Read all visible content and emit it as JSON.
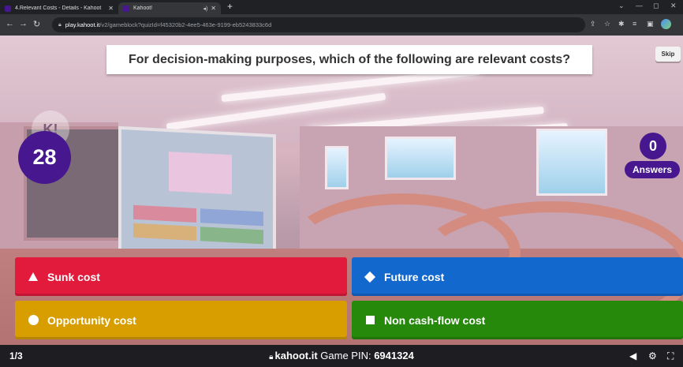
{
  "browser": {
    "tabs": [
      {
        "title": "4.Relevant Costs - Details - Kahoot",
        "close": "✕"
      },
      {
        "title": "Kahoot!",
        "close": "✕",
        "audio": "◂)"
      }
    ],
    "new_tab": "+",
    "window_controls": {
      "minimize": "—",
      "restore": "◻",
      "close": "✕",
      "collapse": "⌄"
    },
    "url_host": "play.kahoot.it",
    "url_path": "/v2/gameblock?quizId=f45320b2-4ee5-463e-9199-eb5243833c6d"
  },
  "game": {
    "question": "For decision-making purposes, which of the following are relevant costs?",
    "skip_label": "Skip",
    "timer": "28",
    "answers_count": "0",
    "answers_label": "Answers",
    "logo_text": "K!",
    "options": [
      {
        "label": "Sunk cost",
        "color": "#e21b3c",
        "shape": "triangle"
      },
      {
        "label": "Future cost",
        "color": "#1368ce",
        "shape": "diamond"
      },
      {
        "label": "Opportunity cost",
        "color": "#d89e00",
        "shape": "circle"
      },
      {
        "label": "Non cash-flow cost",
        "color": "#26890c",
        "shape": "square"
      }
    ]
  },
  "footer": {
    "progress": "1/3",
    "site": "kahoot.it",
    "pin_label": "Game PIN:",
    "pin": "6941324"
  },
  "icons": [
    "back-icon",
    "forward-icon",
    "reload-icon",
    "lock-icon",
    "share-icon",
    "star-icon",
    "extensions-icon",
    "reading-list-icon",
    "sidepanel-icon",
    "volume-icon",
    "settings-icon",
    "fullscreen-icon"
  ]
}
